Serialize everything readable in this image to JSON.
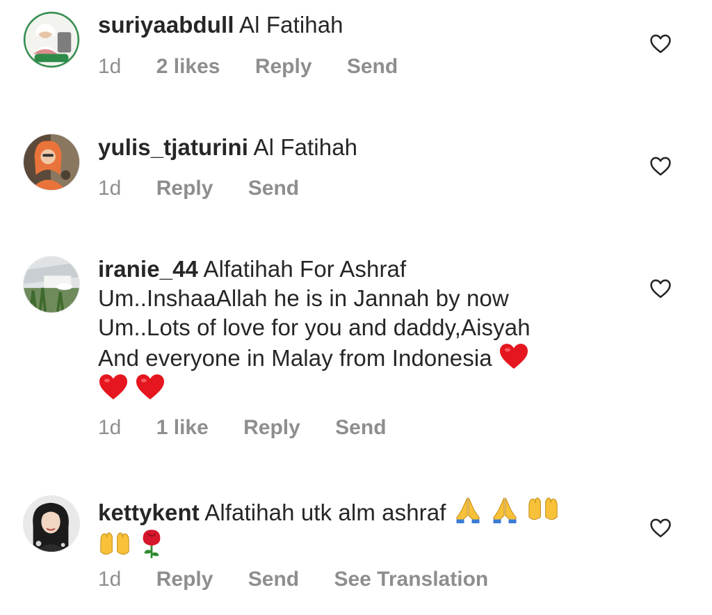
{
  "comments": [
    {
      "username": "suriyaabdull",
      "text": "Al Fatihah",
      "time": "1d",
      "likes": "2 likes",
      "reply": "Reply",
      "send": "Send"
    },
    {
      "username": "yulis_tjaturini",
      "text": "Al Fatihah",
      "time": "1d",
      "reply": "Reply",
      "send": "Send"
    },
    {
      "username": "iranie_44",
      "text_lines": [
        "Alfatihah For Ashraf",
        "Um..InshaaAllah he is in Jannah by now",
        "Um..Lots of love for you and daddy,Aisyah",
        "And everyone in Malay from Indonesia"
      ],
      "emojis": [
        "red-heart",
        "red-heart",
        "red-heart"
      ],
      "time": "1d",
      "likes": "1 like",
      "reply": "Reply",
      "send": "Send"
    },
    {
      "username": "kettykent",
      "text": "Alfatihah utk alm ashraf",
      "emojis": [
        "folded-hands",
        "folded-hands",
        "raising-hands",
        "raising-hands",
        "rose"
      ],
      "time": "1d",
      "reply": "Reply",
      "send": "Send",
      "translate": "See Translation"
    }
  ],
  "colors": {
    "text": "#262626",
    "muted": "#8e8e8e",
    "heart_outline": "#262626",
    "emoji_heart": "#e5161f"
  },
  "icons": {
    "like": "heart-outline-icon"
  }
}
